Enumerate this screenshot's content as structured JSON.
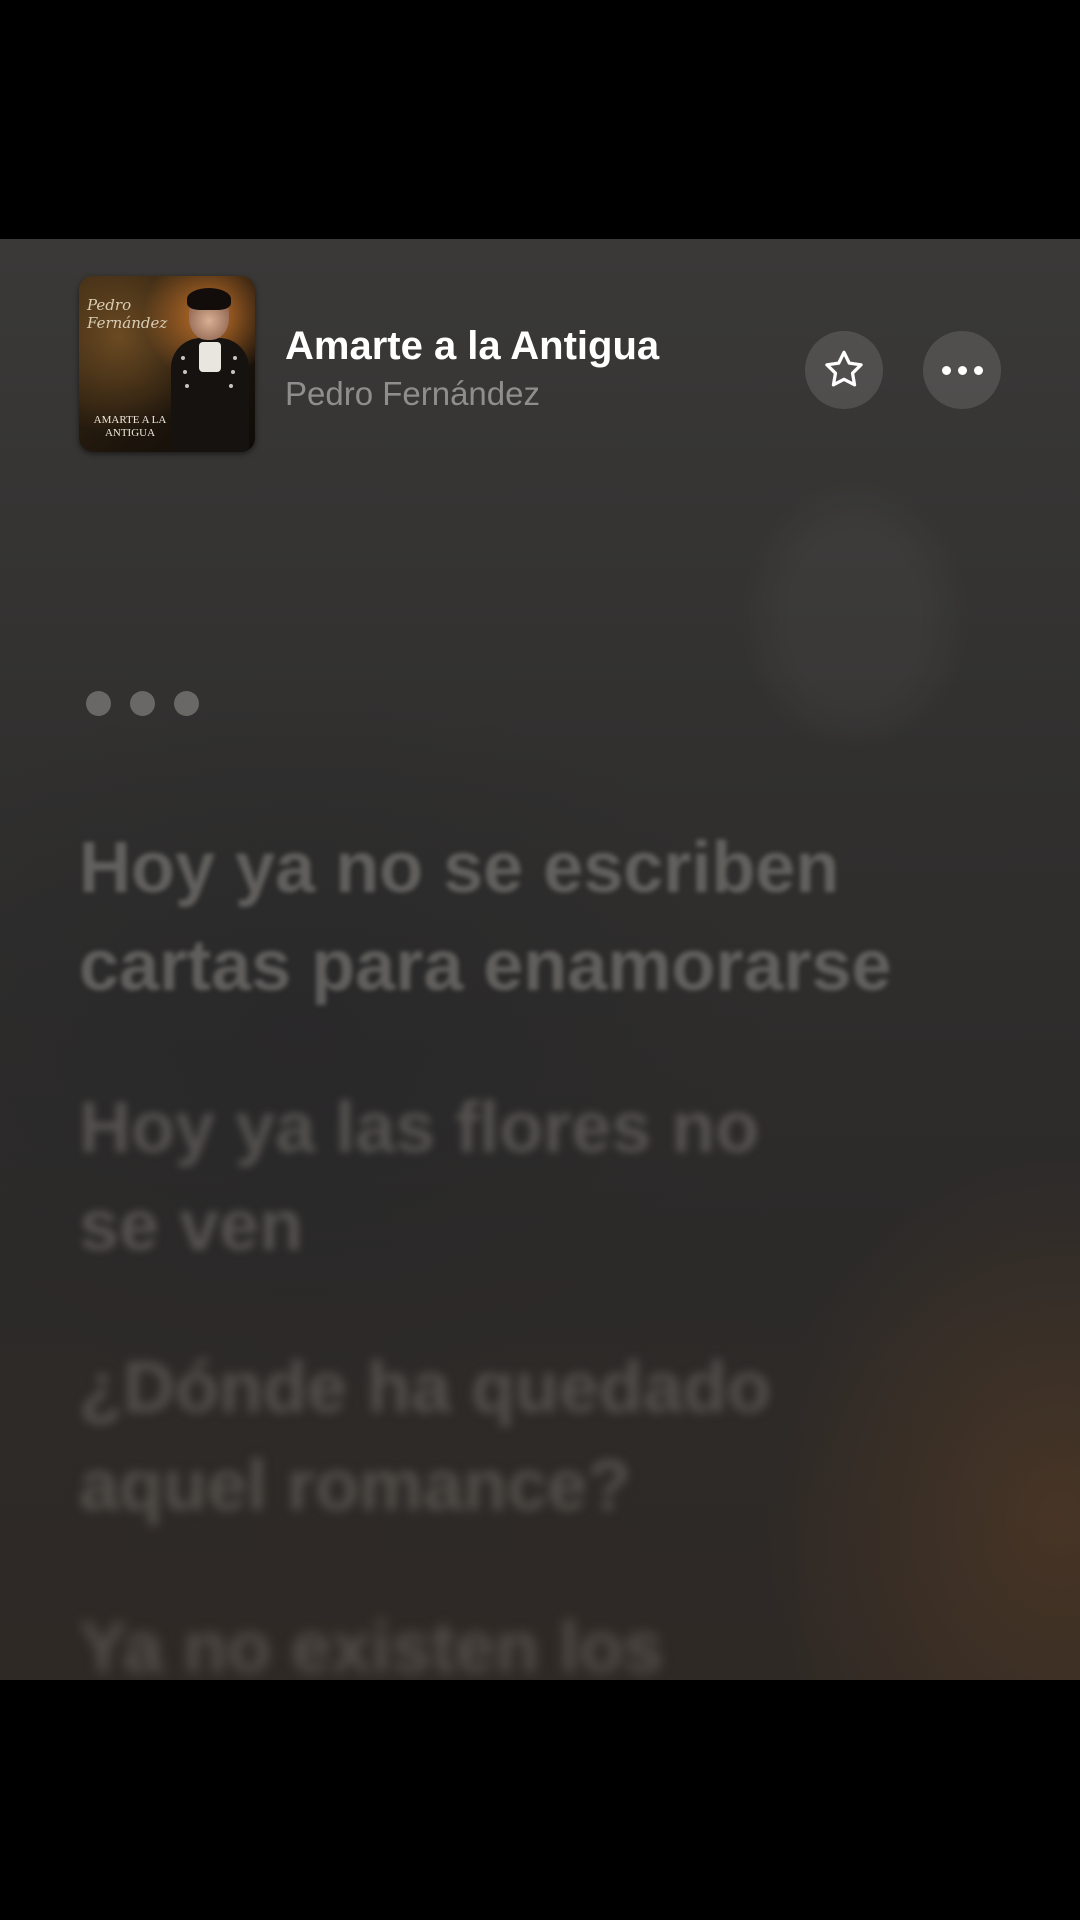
{
  "now_playing": {
    "title": "Amarte a la Antigua",
    "artist": "Pedro Fernández",
    "artwork": {
      "artist_text": "Pedro Fernández",
      "album_text": "AMARTE A LA ANTIGUA"
    }
  },
  "actions": {
    "favorite_icon": "star-outline-icon",
    "more_icon": "ellipsis-icon"
  },
  "lyrics": [
    "Hoy ya no se escriben cartas para enamorarse",
    "Hoy ya las flores no se ven",
    "¿Dónde ha quedado aquel romance?",
    "Ya no existen los"
  ],
  "colors": {
    "background": "#2f2e2d",
    "title": "#ffffff",
    "artist": "#8f8e8c",
    "button_bg": "#474645"
  }
}
